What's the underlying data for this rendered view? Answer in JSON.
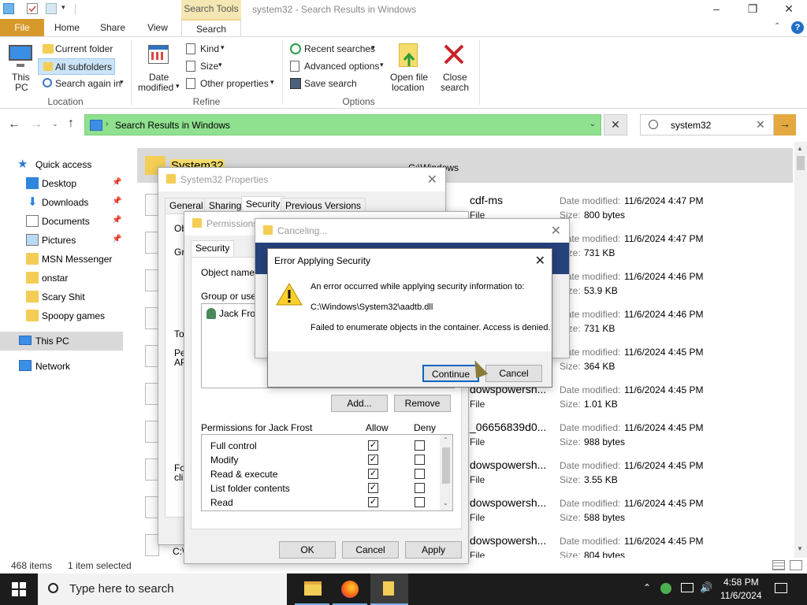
{
  "explorer": {
    "title": "system32 - Search Results in Windows",
    "contextual_tab": "Search Tools",
    "tabs": [
      "File",
      "Home",
      "Share",
      "View",
      "Search"
    ],
    "ribbon": {
      "this_pc_line1": "This",
      "this_pc_line2": "PC",
      "current_folder": "Current folder",
      "all_subfolders": "All subfolders",
      "search_again": "Search again in",
      "location_group": "Location",
      "date_modified_line1": "Date",
      "date_modified_line2": "modified",
      "kind": "Kind",
      "size": "Size",
      "other_properties": "Other properties",
      "refine_group": "Refine",
      "recent_searches": "Recent searches",
      "advanced_options": "Advanced options",
      "save_search": "Save search",
      "open_file_location_line1": "Open file",
      "open_file_location_line2": "location",
      "close_search_line1": "Close",
      "close_search_line2": "search",
      "options_group": "Options"
    },
    "address": "Search Results in Windows",
    "search_value": "system32",
    "nav": [
      {
        "label": "Quick access",
        "pinned": false
      },
      {
        "label": "Desktop",
        "pinned": true
      },
      {
        "label": "Downloads",
        "pinned": true
      },
      {
        "label": "Documents",
        "pinned": true
      },
      {
        "label": "Pictures",
        "pinned": true
      },
      {
        "label": "MSN Messenger",
        "pinned": false
      },
      {
        "label": "onstar",
        "pinned": false
      },
      {
        "label": "Scary Shit",
        "pinned": false
      },
      {
        "label": "Spoopy games",
        "pinned": false
      },
      {
        "label": "This PC",
        "pinned": false
      },
      {
        "label": "Network",
        "pinned": false
      }
    ],
    "result_header": {
      "name": "System32",
      "path": "C:\\Windows"
    },
    "results": [
      {
        "name": "cdf-ms",
        "sub": "File",
        "date_label": "Date modified:",
        "date": "11/6/2024 4:47 PM",
        "size_label": "Size:",
        "size": "800 bytes"
      },
      {
        "name": "",
        "sub": "",
        "date_label": "Date modified:",
        "date": "11/6/2024 4:47 PM",
        "size_label": "Size:",
        "size": "731 KB"
      },
      {
        "name": "",
        "sub": "",
        "date_label": "Date modified:",
        "date": "11/6/2024 4:46 PM",
        "size_label": "Size:",
        "size": "53.9 KB"
      },
      {
        "name": "",
        "sub": "",
        "date_label": "Date modified:",
        "date": "11/6/2024 4:46 PM",
        "size_label": "Size:",
        "size": "731 KB"
      },
      {
        "name": "",
        "sub": "",
        "date_label": "Date modified:",
        "date": "11/6/2024 4:45 PM",
        "size_label": "Size:",
        "size": "364 KB"
      },
      {
        "name": "dowspowersh...",
        "sub": "File",
        "date_label": "Date modified:",
        "date": "11/6/2024 4:45 PM",
        "size_label": "Size:",
        "size": "1.01 KB"
      },
      {
        "name": "_06656839d0...",
        "sub": "File",
        "date_label": "Date modified:",
        "date": "11/6/2024 4:45 PM",
        "size_label": "Size:",
        "size": "988 bytes"
      },
      {
        "name": "dowspowersh...",
        "sub": "File",
        "date_label": "Date modified:",
        "date": "11/6/2024 4:45 PM",
        "size_label": "Size:",
        "size": "3.55 KB"
      },
      {
        "name": "dowspowersh...",
        "sub": "File",
        "date_label": "Date modified:",
        "date": "11/6/2024 4:45 PM",
        "size_label": "Size:",
        "size": "588 bytes"
      },
      {
        "name": "dowspowersh...",
        "sub": "File",
        "date_label": "Date modified:",
        "date": "11/6/2024 4:45 PM",
        "size_label": "Size:",
        "size": "804 bytes"
      }
    ],
    "status_items": "468 items",
    "status_selected": "1 item selected"
  },
  "props": {
    "title": "System32 Properties",
    "tabs": [
      "General",
      "Sharing",
      "Security",
      "Previous Versions"
    ],
    "frag_ob": "Ob",
    "frag_gr": "Gr",
    "frag_to": "To",
    "frag_pe": "Pe",
    "frag_ap": "AP",
    "frag_fo": "Fo",
    "frag_cli": "cli",
    "frag_c": "C:\\"
  },
  "perms": {
    "title": "Permissions",
    "tab": "Security",
    "object_name_label": "Object name:",
    "group_label": "Group or user n",
    "user": "Jack Frost",
    "add": "Add...",
    "remove": "Remove",
    "perm_header": "Permissions for Jack Frost",
    "allow": "Allow",
    "deny": "Deny",
    "rows": [
      {
        "name": "Full control",
        "allow": true,
        "deny": false
      },
      {
        "name": "Modify",
        "allow": true,
        "deny": false
      },
      {
        "name": "Read & execute",
        "allow": true,
        "deny": false
      },
      {
        "name": "List folder contents",
        "allow": true,
        "deny": false
      },
      {
        "name": "Read",
        "allow": true,
        "deny": false
      }
    ],
    "ok": "OK",
    "cancel": "Cancel",
    "apply": "Apply"
  },
  "canceling": {
    "title": "Canceling..."
  },
  "error": {
    "title": "Error Applying Security",
    "line1": "An error occurred while applying security information to:",
    "path": "C:\\Windows\\System32\\aadtb.dll",
    "line2": "Failed to enumerate objects in the container. Access is denied.",
    "continue": "Continue",
    "cancel": "Cancel"
  },
  "taskbar": {
    "search_placeholder": "Type here to search",
    "time": "4:58 PM",
    "date": "11/6/2024"
  },
  "colors": {
    "address_bg": "#8fe08f",
    "file_tab": "#d79a2a",
    "search_tools": "#f5e7b3"
  }
}
